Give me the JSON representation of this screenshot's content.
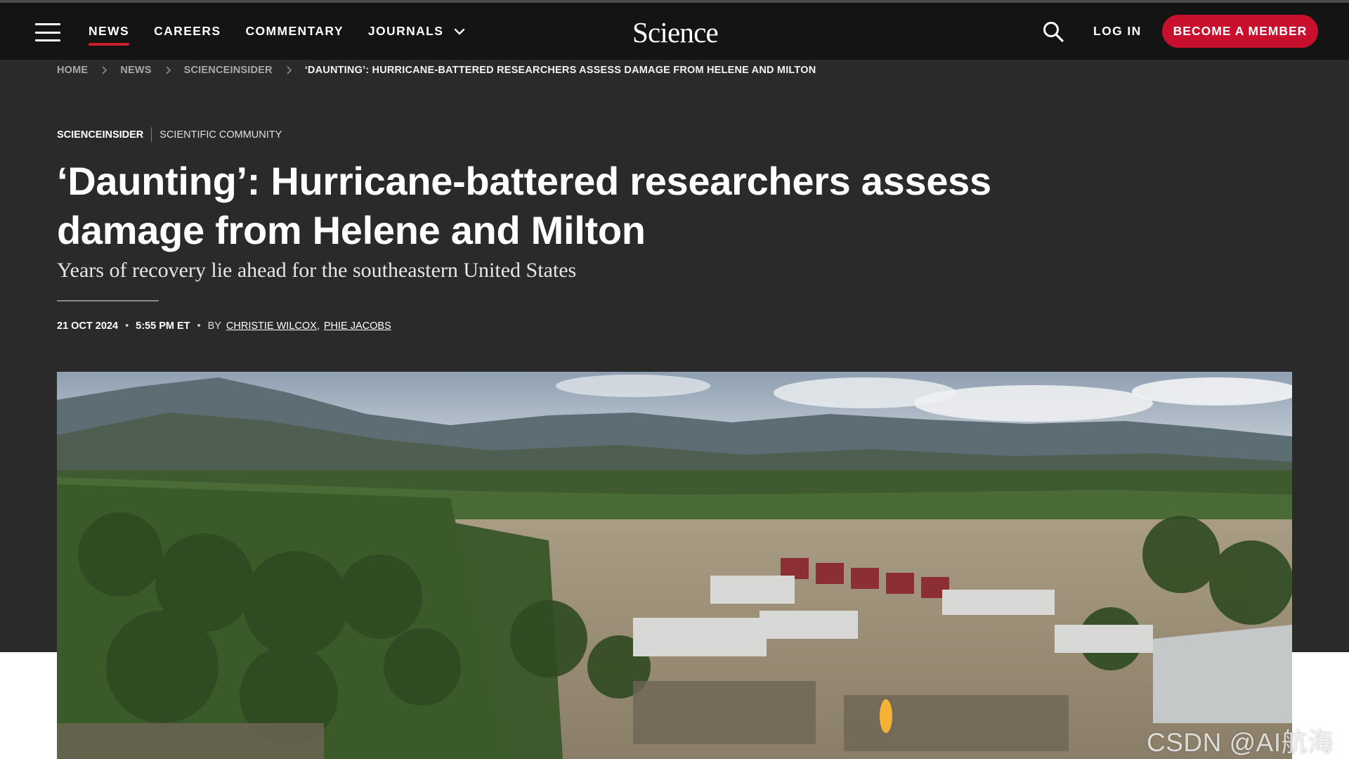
{
  "header": {
    "nav": [
      {
        "label": "NEWS",
        "active": true
      },
      {
        "label": "CAREERS",
        "active": false
      },
      {
        "label": "COMMENTARY",
        "active": false
      },
      {
        "label": "JOURNALS",
        "active": false
      }
    ],
    "logo": "Science",
    "login_label": "LOG IN",
    "member_label": "BECOME A MEMBER",
    "accent_color": "#c8102e"
  },
  "breadcrumb": {
    "items": [
      "HOME",
      "NEWS",
      "SCIENCEINSIDER"
    ],
    "current": "‘DAUNTING’: HURRICANE-BATTERED RESEARCHERS ASSESS DAMAGE FROM HELENE AND MILTON"
  },
  "article": {
    "category_primary": "SCIENCEINSIDER",
    "category_secondary": "SCIENTIFIC COMMUNITY",
    "title": "‘Daunting’: Hurricane-battered researchers assess damage from Helene and Milton",
    "subtitle": "Years of recovery lie ahead for the southeastern United States",
    "date": "21 OCT 2024",
    "time": "5:55 PM ET",
    "by_label": "BY",
    "authors": [
      "CHRISTIE WILCOX",
      "PHIE JACOBS"
    ]
  },
  "watermark": "CSDN @AI航海家"
}
